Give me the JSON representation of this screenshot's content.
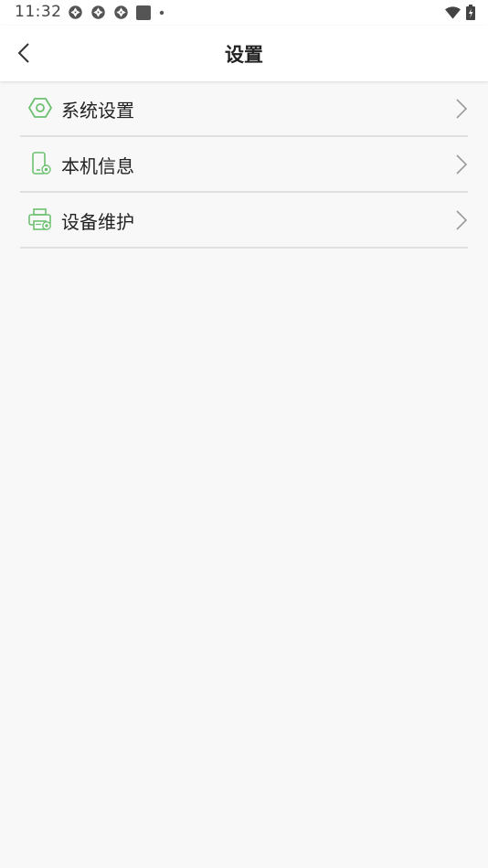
{
  "status_bar": {
    "time": "11:32",
    "notification_icons": [
      "aperture-icon",
      "aperture-icon",
      "aperture-icon",
      "square-icon",
      "dot-icon"
    ],
    "right_icons": [
      "wifi-icon",
      "battery-icon"
    ]
  },
  "header": {
    "title": "设置",
    "back_icon": "chevron-left-icon"
  },
  "menu": {
    "items": [
      {
        "label": "系统设置",
        "icon": "settings-hexagon-icon"
      },
      {
        "label": "本机信息",
        "icon": "device-info-icon"
      },
      {
        "label": "设备维护",
        "icon": "printer-icon"
      }
    ]
  },
  "colors": {
    "accent_green": "#6cc070",
    "divider": "#e0e0e0",
    "background": "#f8f8f8"
  }
}
